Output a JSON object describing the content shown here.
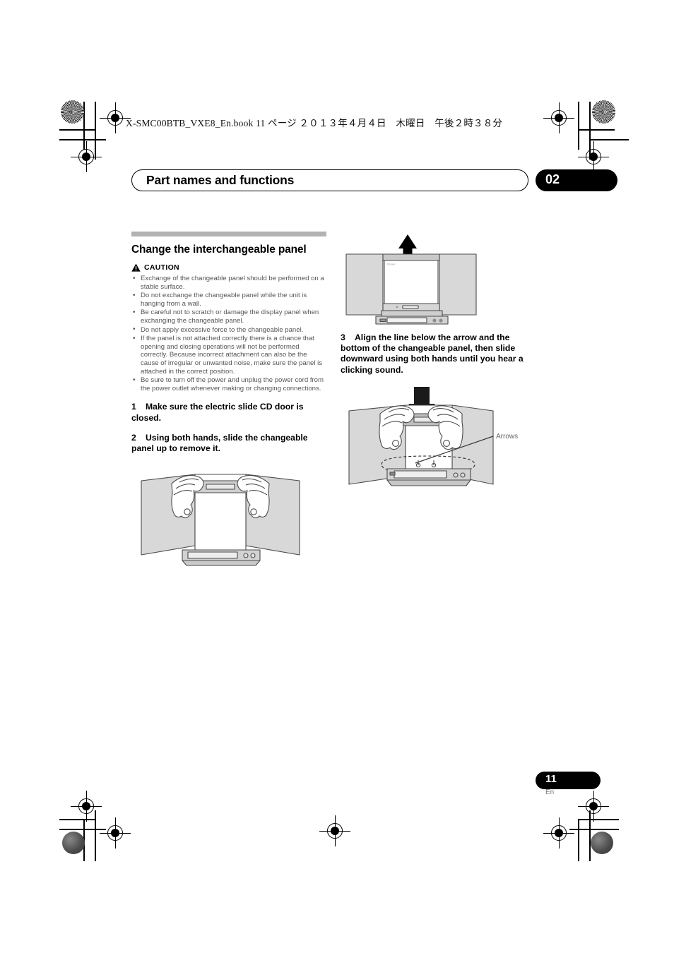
{
  "page": {
    "book_header": "X-SMC00BTB_VXE8_En.book   11 ページ   ２０１３年４月４日　木曜日　午後２時３８分",
    "running_title": "Part names and functions",
    "chapter_number": "02",
    "page_number": "11",
    "language_code": "En"
  },
  "section": {
    "heading": "Change the interchangeable panel",
    "caution_label": "CAUTION",
    "caution_icon": "warning-triangle-icon",
    "bullets": [
      "Exchange of the changeable panel should be performed on a stable surface.",
      "Do not exchange the changeable panel while the unit is hanging from a wall.",
      "Be careful not to scratch or damage the display panel when exchanging the changeable panel.",
      "Do not apply excessive force to the changeable panel.",
      "If the panel is not attached correctly there is a chance that opening and closing operations will not be performed correctly. Because incorrect attachment can also be the cause of irregular or unwanted noise, make sure the panel is attached in the correct position.",
      "Be sure to turn off the power and unplug the power cord from the power outlet whenever making or changing connections."
    ],
    "steps": [
      {
        "number": "1",
        "text": "Make sure the electric slide CD door is closed."
      },
      {
        "number": "2",
        "text": "Using both hands, slide the changeable panel up to remove it."
      },
      {
        "number": "3",
        "text": "Align the line below the arrow and the bottom of the changeable panel, then slide downward using both hands until you hear a clicking sound."
      }
    ]
  },
  "figures": {
    "panel_removal_arrow": {
      "name": "stereo-unit-panel-up-arrow-illustration",
      "arrow_direction": "up",
      "brand_mark": "Pioneer"
    },
    "panel_attach_hands": {
      "name": "hands-sliding-panel-down-illustration",
      "arrow_direction": "down",
      "callout_label": "Arrows"
    },
    "panel_remove_hands": {
      "name": "hands-removing-panel-illustration",
      "arrow_direction": "none"
    }
  },
  "colors": {
    "rule_gray": "#b2b2b2",
    "body_gray": "#555555",
    "badge_black": "#000000",
    "illustration_fill": "#d8d8d8"
  }
}
